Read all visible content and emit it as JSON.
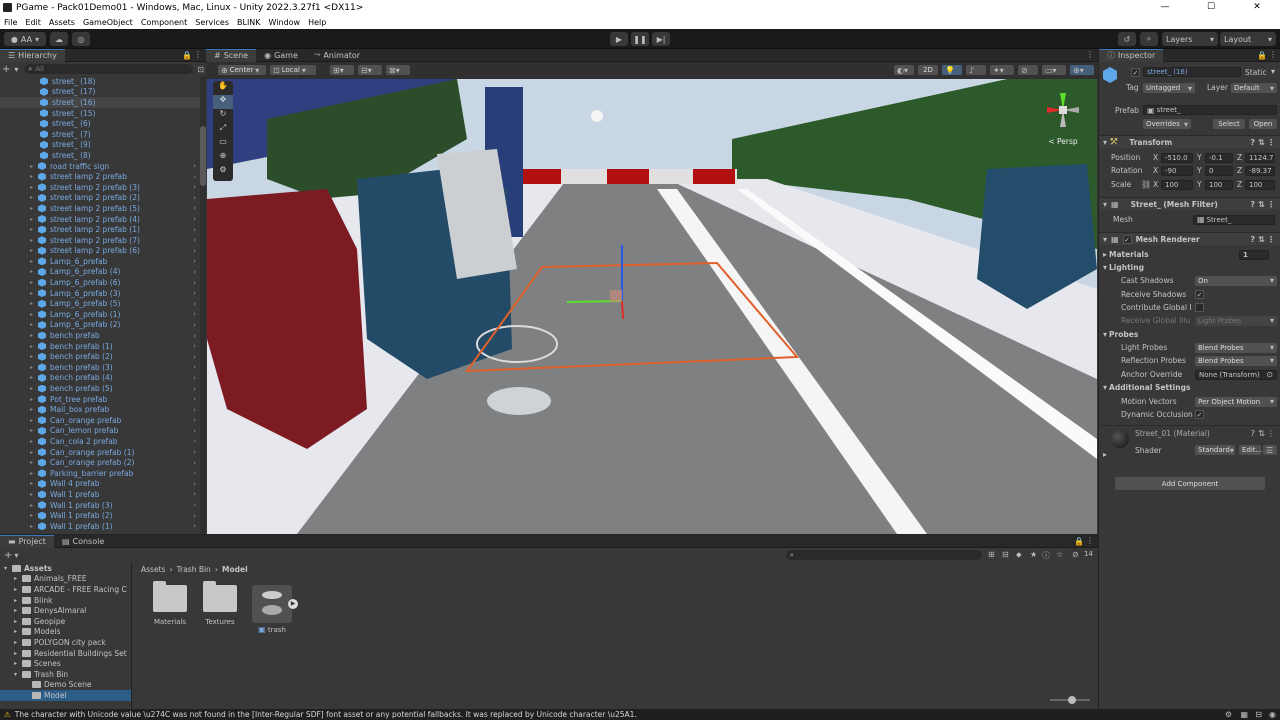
{
  "window": {
    "title": "PGame - Pack01Demo01 - Windows, Mac, Linux - Unity 2022.3.27f1 <DX11>",
    "controls": [
      "—",
      "☐",
      "✕"
    ]
  },
  "menu": [
    "File",
    "Edit",
    "Assets",
    "GameObject",
    "Component",
    "Services",
    "BLINK",
    "Window",
    "Help"
  ],
  "toolbar": {
    "account": "AA",
    "layers": "Layers",
    "layout": "Layout"
  },
  "hierarchy": {
    "tab": "Hierarchy",
    "search_placeholder": "All",
    "items": [
      {
        "label": "street_ (18)",
        "expandable": false,
        "selected": false
      },
      {
        "label": "street_ (17)",
        "expandable": false,
        "selected": false
      },
      {
        "label": "street_ (16)",
        "expandable": false,
        "selected": true
      },
      {
        "label": "street_ (15)",
        "expandable": false,
        "selected": false
      },
      {
        "label": "street_ (6)",
        "expandable": false,
        "selected": false
      },
      {
        "label": "street_ (7)",
        "expandable": false,
        "selected": false
      },
      {
        "label": "street_ (9)",
        "expandable": false,
        "selected": false
      },
      {
        "label": "street_ (8)",
        "expandable": false,
        "selected": false
      },
      {
        "label": "road traffic sign",
        "expandable": true,
        "selected": false
      },
      {
        "label": "street lamp 2 prefab",
        "expandable": true,
        "selected": false
      },
      {
        "label": "street lamp 2 prefab (3)",
        "expandable": true,
        "selected": false
      },
      {
        "label": "street lamp 2 prefab (2)",
        "expandable": true,
        "selected": false
      },
      {
        "label": "street lamp 2 prefab (5)",
        "expandable": true,
        "selected": false
      },
      {
        "label": "street lamp 2 prefab (4)",
        "expandable": true,
        "selected": false
      },
      {
        "label": "street lamp 2 prefab (1)",
        "expandable": true,
        "selected": false
      },
      {
        "label": "street lamp 2 prefab (7)",
        "expandable": true,
        "selected": false
      },
      {
        "label": "street lamp 2 prefab (6)",
        "expandable": true,
        "selected": false
      },
      {
        "label": "Lamp_6_prefab",
        "expandable": true,
        "selected": false
      },
      {
        "label": "Lamp_6_prefab (4)",
        "expandable": true,
        "selected": false
      },
      {
        "label": "Lamp_6_prefab (6)",
        "expandable": true,
        "selected": false
      },
      {
        "label": "Lamp_6_prefab (3)",
        "expandable": true,
        "selected": false
      },
      {
        "label": "Lamp_6_prefab (5)",
        "expandable": true,
        "selected": false
      },
      {
        "label": "Lamp_6_prefab (1)",
        "expandable": true,
        "selected": false
      },
      {
        "label": "Lamp_6_prefab (2)",
        "expandable": true,
        "selected": false
      },
      {
        "label": "bench prefab",
        "expandable": true,
        "selected": false
      },
      {
        "label": "bench prefab (1)",
        "expandable": true,
        "selected": false
      },
      {
        "label": "bench prefab (2)",
        "expandable": true,
        "selected": false
      },
      {
        "label": "bench prefab (3)",
        "expandable": true,
        "selected": false
      },
      {
        "label": "bench prefab (4)",
        "expandable": true,
        "selected": false
      },
      {
        "label": "bench prefab (5)",
        "expandable": true,
        "selected": false
      },
      {
        "label": "Pot_tree prefab",
        "expandable": true,
        "selected": false
      },
      {
        "label": "Mail_box prefab",
        "expandable": true,
        "selected": false
      },
      {
        "label": "Can_orange prefab",
        "expandable": true,
        "selected": false
      },
      {
        "label": "Can_lemon prefab",
        "expandable": true,
        "selected": false
      },
      {
        "label": "Can_cola 2 prefab",
        "expandable": true,
        "selected": false
      },
      {
        "label": "Can_orange prefab (1)",
        "expandable": true,
        "selected": false
      },
      {
        "label": "Can_orange prefab (2)",
        "expandable": true,
        "selected": false
      },
      {
        "label": "Parking_barrier prefab",
        "expandable": true,
        "selected": false
      },
      {
        "label": "Wall 4 prefab",
        "expandable": true,
        "selected": false
      },
      {
        "label": "Wall 1 prefab",
        "expandable": true,
        "selected": false
      },
      {
        "label": "Wall 1 prefab (3)",
        "expandable": true,
        "selected": false
      },
      {
        "label": "Wall 1 prefab (2)",
        "expandable": true,
        "selected": false
      },
      {
        "label": "Wall 1 prefab (1)",
        "expandable": true,
        "selected": false
      }
    ]
  },
  "scene": {
    "tabs": [
      "Scene",
      "Game",
      "Animator"
    ],
    "pivot": "Center",
    "space": "Local",
    "mode2d": "2D",
    "persp": "< Persp"
  },
  "inspector": {
    "tab": "Inspector",
    "object_name": "street_ (16)",
    "static": "Static",
    "tag_label": "Tag",
    "tag": "Untagged",
    "layer_label": "Layer",
    "layer": "Default",
    "prefab_label": "Prefab",
    "prefab": "street_",
    "overrides": "Overrides",
    "select": "Select",
    "open": "Open",
    "transform": {
      "title": "Transform",
      "position_label": "Position",
      "rotation_label": "Rotation",
      "scale_label": "Scale",
      "position": [
        "-510.0",
        "-0.1",
        "1124.7"
      ],
      "rotation": [
        "-90",
        "0",
        "-89.37"
      ],
      "scale": [
        "100",
        "100",
        "100"
      ]
    },
    "mesh_filter": {
      "title": "Street_ (Mesh Filter)",
      "mesh_label": "Mesh",
      "mesh": "Street_"
    },
    "mesh_renderer": {
      "title": "Mesh Renderer",
      "materials_label": "Materials",
      "materials_count": "1",
      "lighting": "Lighting",
      "cast_shadows_label": "Cast Shadows",
      "cast_shadows": "On",
      "receive_shadows": "Receive Shadows",
      "contribute_gi": "Contribute Global I",
      "receive_gi_label": "Receive Global Illu",
      "receive_gi": "Light Probes",
      "probes": "Probes",
      "light_probes_label": "Light Probes",
      "light_probes": "Blend Probes",
      "reflection_probes_label": "Reflection Probes",
      "reflection_probes": "Blend Probes",
      "anchor_override_label": "Anchor Override",
      "anchor_override": "None (Transform)",
      "additional": "Additional Settings",
      "motion_vectors_label": "Motion Vectors",
      "motion_vectors": "Per Object Motion",
      "dynamic_occlusion": "Dynamic Occlusion"
    },
    "material": {
      "title": "Street_01 (Material)",
      "shader_label": "Shader",
      "shader": "Standard",
      "edit": "Edit..."
    },
    "add_component": "Add Component"
  },
  "project": {
    "tabs": [
      "Project",
      "Console"
    ],
    "breadcrumb": [
      "Assets",
      "Trash Bin",
      "Model"
    ],
    "hidden_count": "14",
    "tree": [
      {
        "label": "Assets",
        "depth": 0,
        "bold": true
      },
      {
        "label": "Animals_FREE",
        "depth": 1,
        "bold": false
      },
      {
        "label": "ARCADE - FREE Racing C",
        "depth": 1,
        "bold": false
      },
      {
        "label": "Blink",
        "depth": 1,
        "bold": false
      },
      {
        "label": "DenysAlmaral",
        "depth": 1,
        "bold": false
      },
      {
        "label": "Geopipe",
        "depth": 1,
        "bold": false
      },
      {
        "label": "Models",
        "depth": 1,
        "bold": false
      },
      {
        "label": "POLYGON city pack",
        "depth": 1,
        "bold": false
      },
      {
        "label": "Residential Buildings Set",
        "depth": 1,
        "bold": false
      },
      {
        "label": "Scenes",
        "depth": 1,
        "bold": false
      },
      {
        "label": "Trash Bin",
        "depth": 1,
        "bold": false
      },
      {
        "label": "Demo Scene",
        "depth": 2,
        "bold": false
      },
      {
        "label": "Model",
        "depth": 2,
        "bold": false
      }
    ],
    "assets": [
      "Materials",
      "Textures",
      "trash"
    ]
  },
  "status": {
    "message": "The character with Unicode value \\u274C was not found in the [Inter-Regular SDF] font asset or any potential fallbacks. It was replaced by Unicode character \\u25A1."
  },
  "colors": {
    "accent": "#3a79bb",
    "prefab_blue": "#7aa9e0",
    "panel": "#383838",
    "toolbar": "#191919"
  }
}
